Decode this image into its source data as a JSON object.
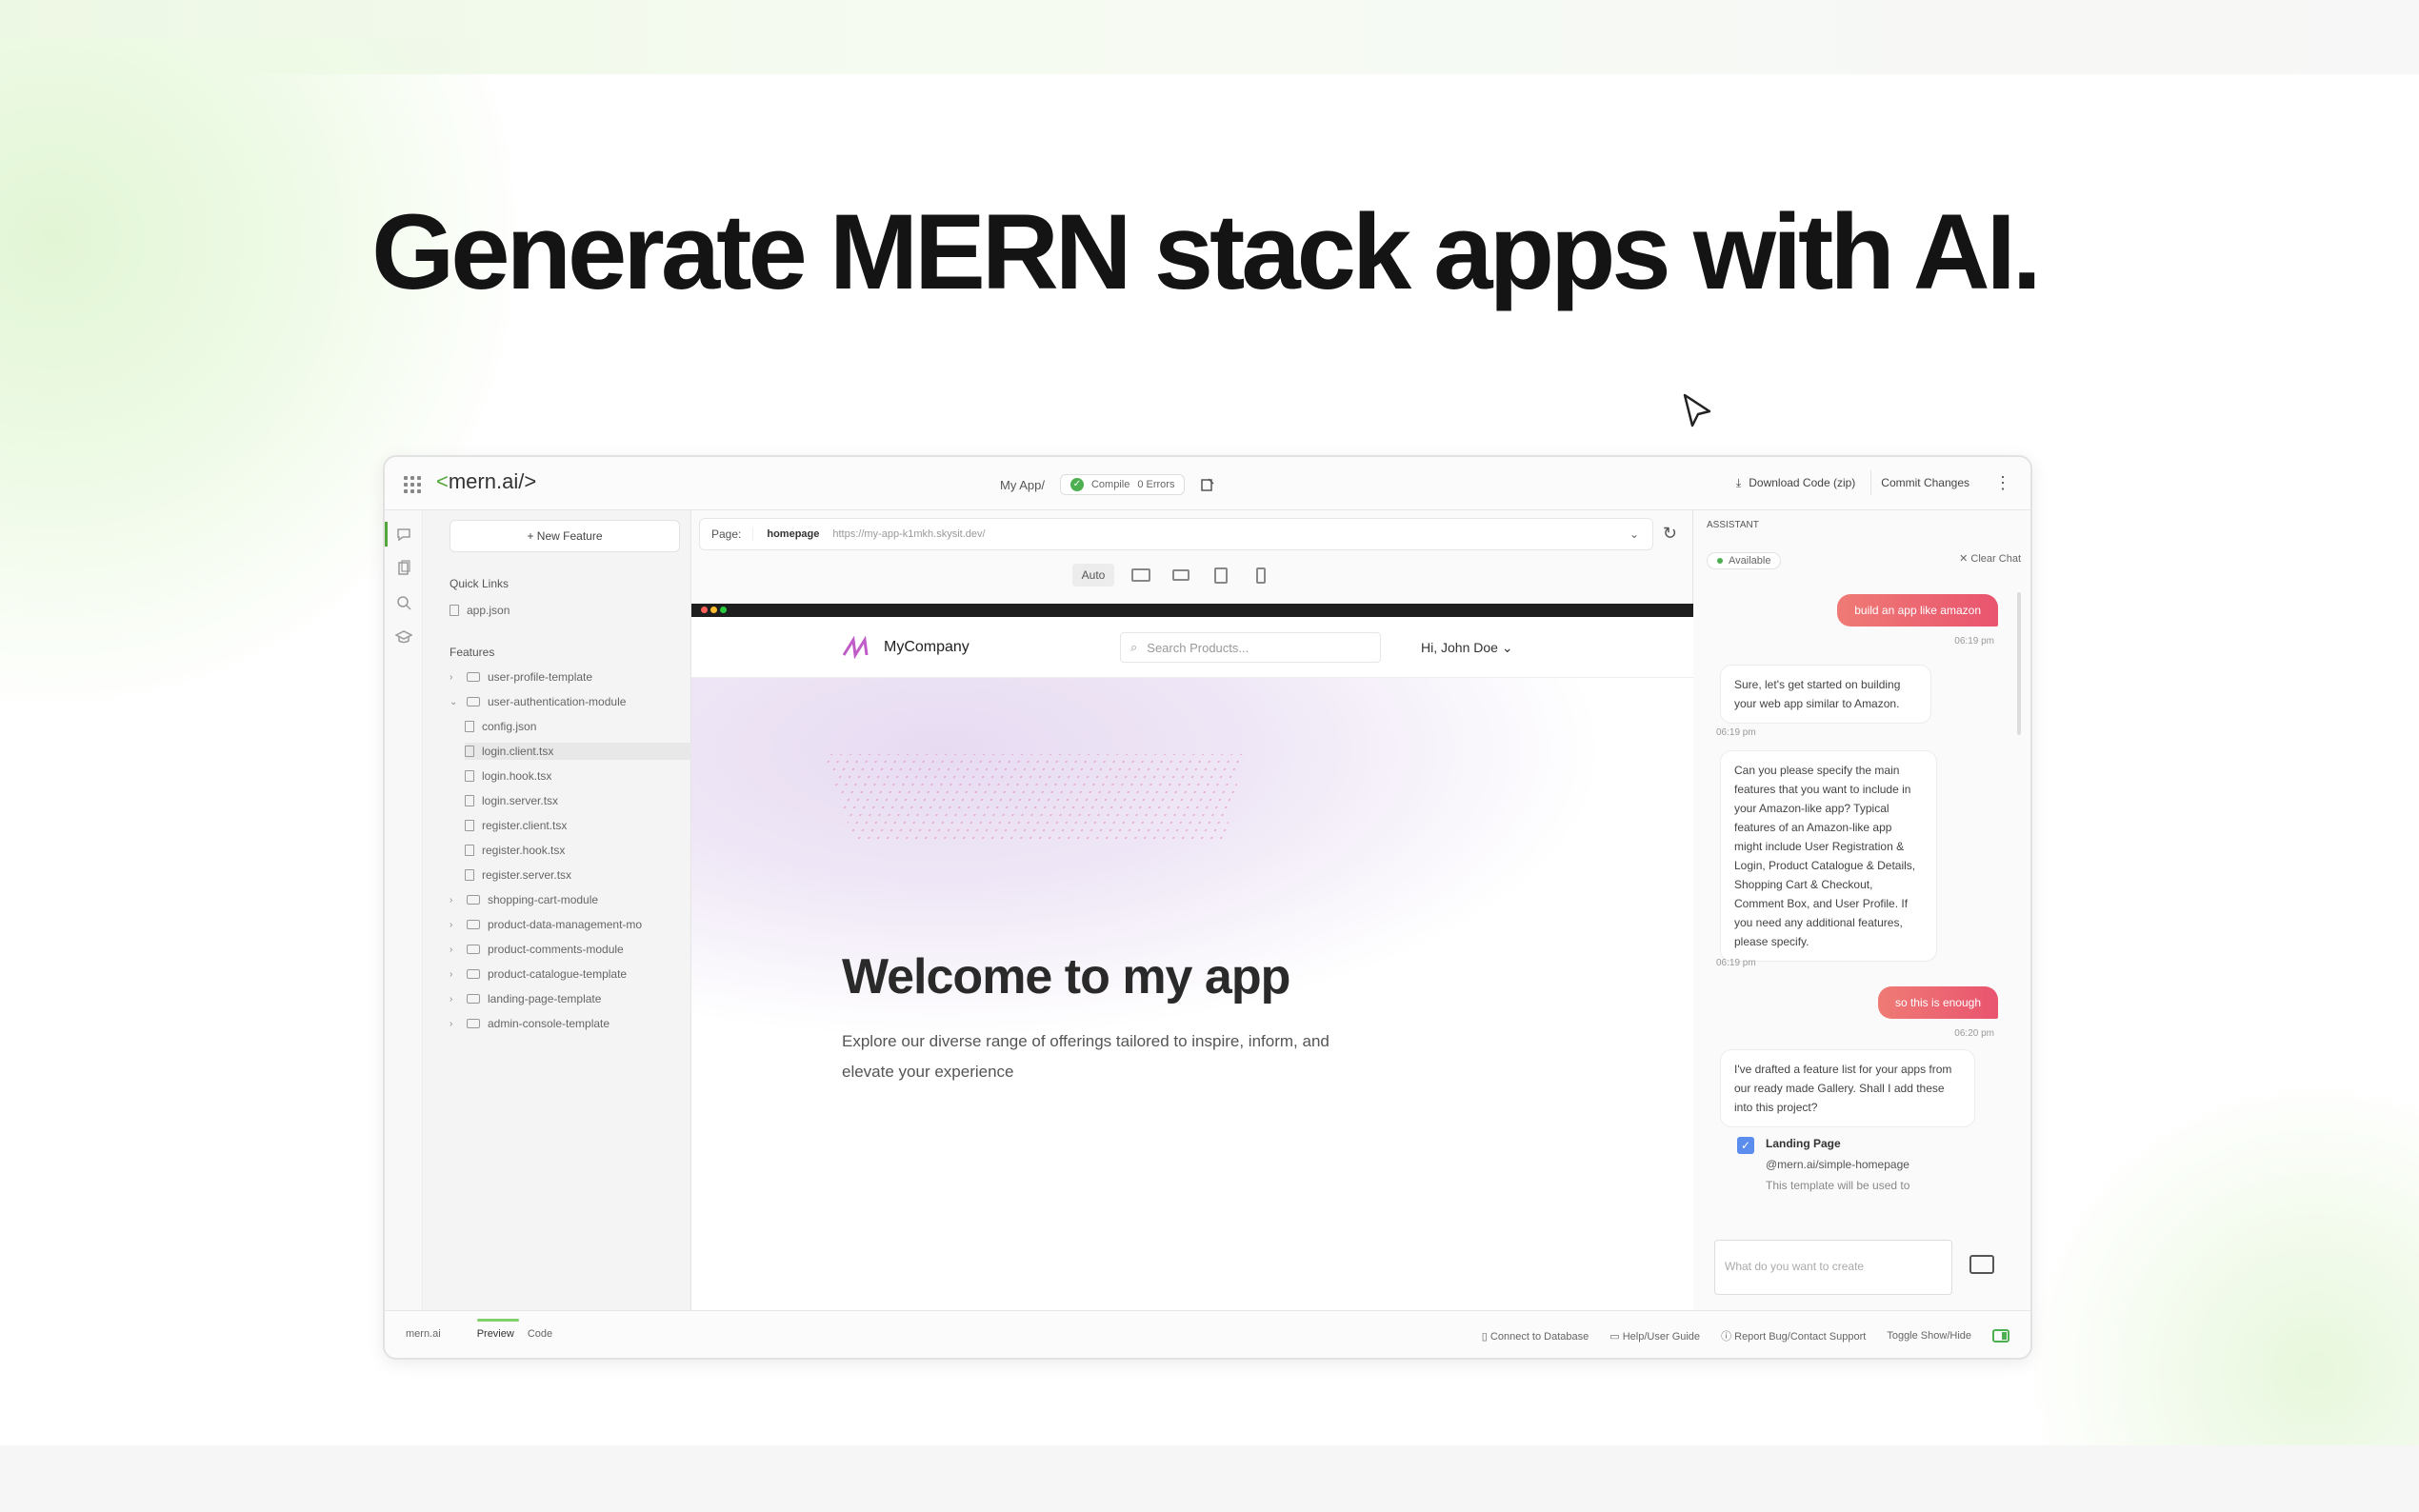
{
  "headline": "Generate MERN stack apps with AI.",
  "app": {
    "logo": {
      "prefix": "<",
      "name": "mern.ai",
      "suffix": "/>"
    },
    "project_name": "My App/",
    "compile_status": "Compile",
    "error_count": "0 Errors",
    "download_label": "Download Code (zip)",
    "commit_label": "Commit Changes",
    "explorer": {
      "new_feature_label": "+ New Feature",
      "quick_links_heading": "Quick Links",
      "quick_links": [
        "app.json"
      ],
      "features_heading": "Features",
      "tree": [
        {
          "label": "user-profile-template",
          "type": "folder",
          "expanded": false
        },
        {
          "label": "user-authentication-module",
          "type": "folder",
          "expanded": true
        },
        {
          "label": "config.json",
          "type": "file"
        },
        {
          "label": "login.client.tsx",
          "type": "file",
          "selected": true
        },
        {
          "label": "login.hook.tsx",
          "type": "file"
        },
        {
          "label": "login.server.tsx",
          "type": "file"
        },
        {
          "label": "register.client.tsx",
          "type": "file"
        },
        {
          "label": "register.hook.tsx",
          "type": "file"
        },
        {
          "label": "register.server.tsx",
          "type": "file"
        },
        {
          "label": "shopping-cart-module",
          "type": "folder",
          "expanded": false
        },
        {
          "label": "product-data-management-mo",
          "type": "folder",
          "expanded": false
        },
        {
          "label": "product-comments-module",
          "type": "folder",
          "expanded": false
        },
        {
          "label": "product-catalogue-template",
          "type": "folder",
          "expanded": false
        },
        {
          "label": "landing-page-template",
          "type": "folder",
          "expanded": false
        },
        {
          "label": "admin-console-template",
          "type": "folder",
          "expanded": false
        }
      ]
    },
    "preview": {
      "page_label": "Page:",
      "page_value": "homepage",
      "url": "https://my-app-k1mkh.skysit.dev/",
      "device_modes": [
        "Auto",
        "desktop",
        "laptop",
        "tablet",
        "mobile"
      ],
      "site": {
        "brand": "MyCompany",
        "search_placeholder": "Search Products...",
        "user_greeting": "Hi, John Doe",
        "hero_title": "Welcome to my app",
        "hero_subtitle": "Explore our diverse range of offerings tailored to inspire, inform, and elevate your experience"
      }
    },
    "assistant": {
      "title": "ASSISTANT",
      "status": "Available",
      "clear_chat": "Clear Chat",
      "messages": [
        {
          "role": "user",
          "text": "build an app like amazon",
          "time": "06:19 pm"
        },
        {
          "role": "ai",
          "text": "Sure, let's get started on building your web app similar to Amazon.",
          "time": "06:19 pm"
        },
        {
          "role": "ai",
          "text": "Can you please specify the main features that you want to include in your Amazon-like app? Typical features of an Amazon-like app might include User Registration & Login, Product Catalogue & Details, Shopping Cart & Checkout, Comment Box, and User Profile. If you need any additional features, please specify.",
          "time": "06:19 pm"
        },
        {
          "role": "user",
          "text": "so this is enough",
          "time": "06:20 pm"
        },
        {
          "role": "ai",
          "text": "I've drafted a feature list for your apps from our ready made Gallery. Shall I add these into this project?"
        }
      ],
      "feature_item": {
        "title": "Landing Page",
        "path": "@mern.ai/simple-homepage",
        "desc": "This template will be used to"
      },
      "input_placeholder": "What do you want to create"
    },
    "footer": {
      "brand": "mern.ai",
      "tab_preview": "Preview",
      "tab_code": "Code",
      "connect_db": "Connect to Database",
      "help": "Help/User Guide",
      "report": "Report Bug/Contact Support",
      "toggle": "Toggle Show/Hide"
    }
  }
}
